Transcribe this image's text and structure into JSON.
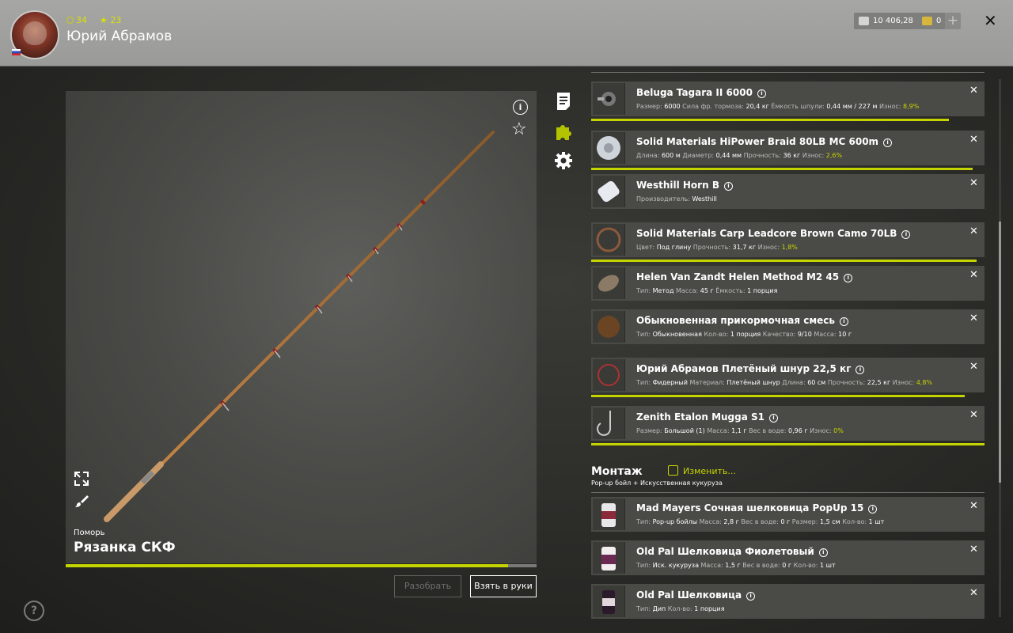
{
  "header": {
    "stats": {
      "level_a": "34",
      "level_b": "23"
    },
    "username": "Юрий Абрамов",
    "silver": "10 406,28",
    "gold": "0",
    "plus_label": "+",
    "close_label": "✕"
  },
  "viewer": {
    "rod_type": "Поморь",
    "rod_name": "Рязанка СКФ",
    "wear_fraction": 0.94,
    "info_label": "i",
    "star_label": "☆",
    "btn_disassemble": "Разобрать",
    "btn_take": "Взять в руки",
    "help_label": "?"
  },
  "tackle": [
    {
      "name": "Beluga Tagara II 6000",
      "props": [
        [
          "Размер:",
          "6000"
        ],
        [
          "Сила фр. тормоза:",
          "20,4 кг"
        ],
        [
          "Ёмкость шпули:",
          "0,44 мм / 227 м"
        ],
        [
          "Износ:",
          "8,9%"
        ]
      ],
      "wear_bar": 0.91
    },
    {
      "name": "Solid Materials HiPower Braid 80LB MC 600m",
      "props": [
        [
          "Длина:",
          "600 м"
        ],
        [
          "Диаметр:",
          "0,44 мм"
        ],
        [
          "Прочность:",
          "36 кг"
        ],
        [
          "Износ:",
          "2,6%"
        ]
      ],
      "wear_bar": 0.97
    },
    {
      "name": "Westhill Horn B",
      "props": [
        [
          "Производитель:",
          "Westhill"
        ]
      ],
      "wear_bar": null
    },
    {
      "name": "Solid Materials Carp Leadcore Brown Camo 70LB",
      "props": [
        [
          "Цвет:",
          "Под глину"
        ],
        [
          "Прочность:",
          "31,7 кг"
        ],
        [
          "Износ:",
          "1,8%"
        ]
      ],
      "wear_bar": 0.98
    },
    {
      "name": "Helen Van Zandt Helen Method M2 45",
      "props": [
        [
          "Тип:",
          "Метод"
        ],
        [
          "Масса:",
          "45 г"
        ],
        [
          "Ёмкость:",
          "1 порция"
        ]
      ],
      "wear_bar": null
    },
    {
      "name": "Обыкновенная прикормочная смесь",
      "props": [
        [
          "Тип:",
          "Обыкновенная"
        ],
        [
          "Кол-во:",
          "1 порция"
        ],
        [
          "Качество:",
          "9/10"
        ],
        [
          "Масса:",
          "10 г"
        ]
      ],
      "wear_bar": null
    },
    {
      "name": "Юрий Абрамов Плетёный шнур 22,5 кг",
      "props": [
        [
          "Тип:",
          "Фидерный"
        ],
        [
          "Материал:",
          "Плетёный шнур"
        ],
        [
          "Длина:",
          "60 см"
        ],
        [
          "Прочность:",
          "22,5 кг"
        ],
        [
          "Износ:",
          "4,8%"
        ]
      ],
      "wear_bar": 0.95
    },
    {
      "name": "Zenith Etalon Mugga S1",
      "props": [
        [
          "Размер:",
          "Большой (1)"
        ],
        [
          "Масса:",
          "1,1 г"
        ],
        [
          "Вес в воде:",
          "0,96 г"
        ],
        [
          "Износ:",
          "0%"
        ]
      ],
      "wear_bar": 1.0
    }
  ],
  "montage": {
    "title": "Монтаж",
    "edit_label": "Изменить...",
    "subtitle": "Pop-up бойл + Искусственная кукуруза"
  },
  "baits": [
    {
      "name": "Mad Mayers Сочная шелковица PopUp 15",
      "props": [
        [
          "Тип:",
          "Pop-up бойлы"
        ],
        [
          "Масса:",
          "2,8 г"
        ],
        [
          "Вес в воде:",
          "0 г"
        ],
        [
          "Размер:",
          "1,5 см"
        ],
        [
          "Кол-во:",
          "1 шт"
        ]
      ]
    },
    {
      "name": "Old Pal Шелковица Фиолетовый",
      "props": [
        [
          "Тип:",
          "Иск. кукуруза"
        ],
        [
          "Масса:",
          "1,5 г"
        ],
        [
          "Вес в воде:",
          "0 г"
        ],
        [
          "Кол-во:",
          "1 шт"
        ]
      ]
    },
    {
      "name": "Old Pal Шелковица",
      "props": [
        [
          "Тип:",
          "Дип"
        ],
        [
          "Кол-во:",
          "1 порция"
        ]
      ]
    }
  ],
  "colors": {
    "accent": "#c4d400",
    "panel": "#4a4a47"
  }
}
